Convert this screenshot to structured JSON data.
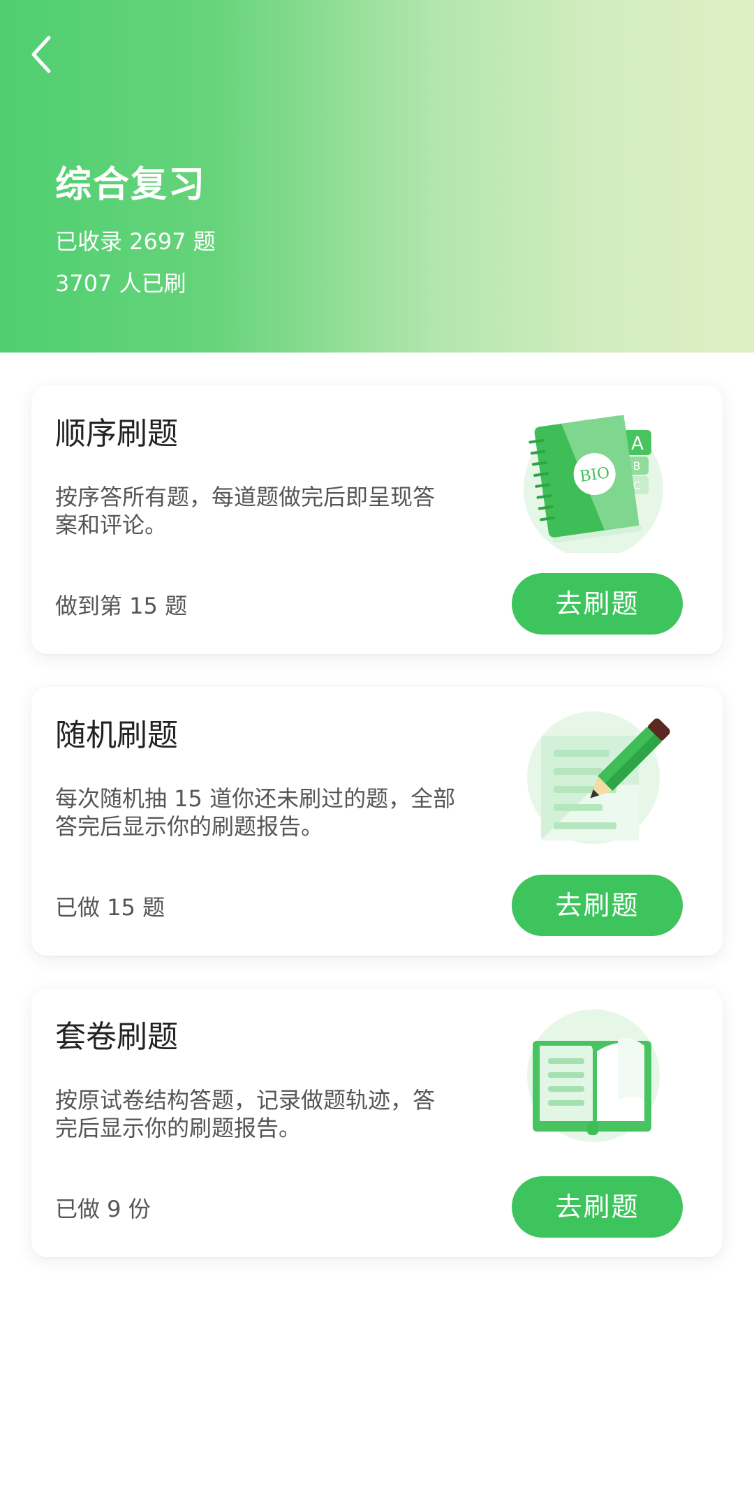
{
  "header": {
    "title": "综合复习",
    "collected": "已收录 2697 题",
    "participants": "3707 人已刷"
  },
  "cards": [
    {
      "title": "顺序刷题",
      "desc_line1": "按序答所有题，每道题做完后即呈现答",
      "desc_line2": "案和评论。",
      "progress": "做到第 15 题",
      "button_label": "去刷题",
      "icon": "bio-notebook-icon",
      "icon_text": "BIO",
      "tab_letters": [
        "A",
        "B",
        "C"
      ]
    },
    {
      "title": "随机刷题",
      "desc_line1": "每次随机抽 15 道你还未刷过的题，全部",
      "desc_line2": "答完后显示你的刷题报告。",
      "progress": "已做 15 题",
      "button_label": "去刷题",
      "icon": "pencil-paper-icon"
    },
    {
      "title": "套卷刷题",
      "desc_line1": "按原试卷结构答题，记录做题轨迹，答",
      "desc_line2": "完后显示你的刷题报告。",
      "progress": "已做 9 份",
      "button_label": "去刷题",
      "icon": "open-book-icon"
    }
  ],
  "colors": {
    "accent": "#3dc45c",
    "header_gradient_start": "#4fcf70",
    "header_gradient_end": "#ddf0c4"
  }
}
